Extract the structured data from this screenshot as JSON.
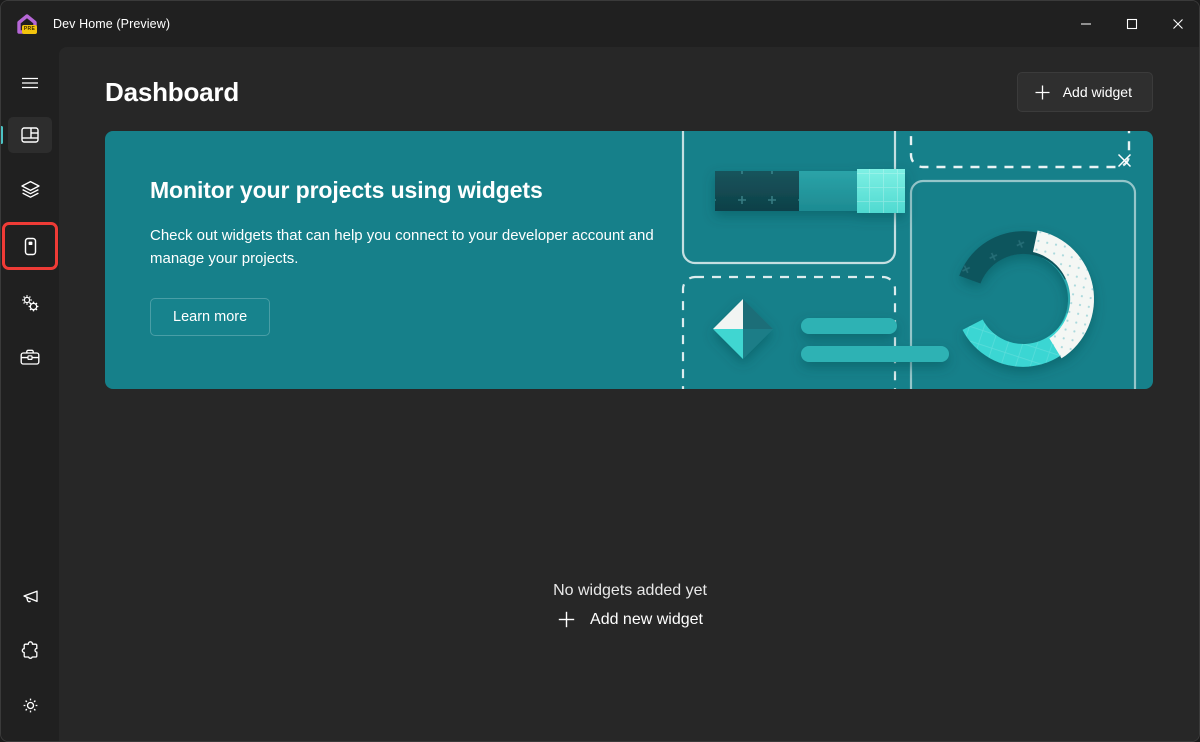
{
  "window": {
    "app_title": "Dev Home (Preview)",
    "app_icon": "dev-home-house-icon",
    "badge_text": "PRE",
    "controls": {
      "minimize": "minimize-icon",
      "maximize": "maximize-icon",
      "close": "close-icon"
    }
  },
  "sidebar": {
    "menu_icon": "hamburger-menu-icon",
    "top_items": [
      {
        "icon": "dashboard-icon",
        "name": "dashboard",
        "selected": true,
        "highlighted": false
      },
      {
        "icon": "layers-icon",
        "name": "machine-configuration",
        "selected": false,
        "highlighted": false
      },
      {
        "icon": "environments-icon",
        "name": "environments",
        "selected": false,
        "highlighted": true
      },
      {
        "icon": "gears-icon",
        "name": "utilities",
        "selected": false,
        "highlighted": false
      },
      {
        "icon": "toolbox-icon",
        "name": "dev-toolbox",
        "selected": false,
        "highlighted": false
      }
    ],
    "bottom_items": [
      {
        "icon": "megaphone-icon",
        "name": "feedback",
        "selected": false
      },
      {
        "icon": "puzzle-piece-icon",
        "name": "extensions",
        "selected": false
      },
      {
        "icon": "gear-icon",
        "name": "settings",
        "selected": false
      }
    ]
  },
  "header": {
    "title": "Dashboard",
    "add_widget_label": "Add widget",
    "add_widget_icon": "plus-icon"
  },
  "banner": {
    "title": "Monitor your projects using widgets",
    "description": "Check out widgets that can help you connect to your developer account and manage your projects.",
    "button_label": "Learn more",
    "close_icon": "close-icon",
    "art": {
      "donut_segments": [
        "white",
        "dark-teal",
        "mid-teal",
        "bright-cyan"
      ],
      "shapes": [
        "bar-chart-3d",
        "diamond-3d",
        "bar-lines"
      ]
    }
  },
  "empty_state": {
    "title": "No widgets added yet",
    "add_label": "Add new widget",
    "add_icon": "plus-icon"
  },
  "colors": {
    "accent_teal": "#16808a",
    "selection_indicator": "#4cc2c4",
    "highlight_box": "#ef3b36",
    "window_bg": "#202020",
    "content_bg": "#272727",
    "text_primary": "#ffffff"
  }
}
